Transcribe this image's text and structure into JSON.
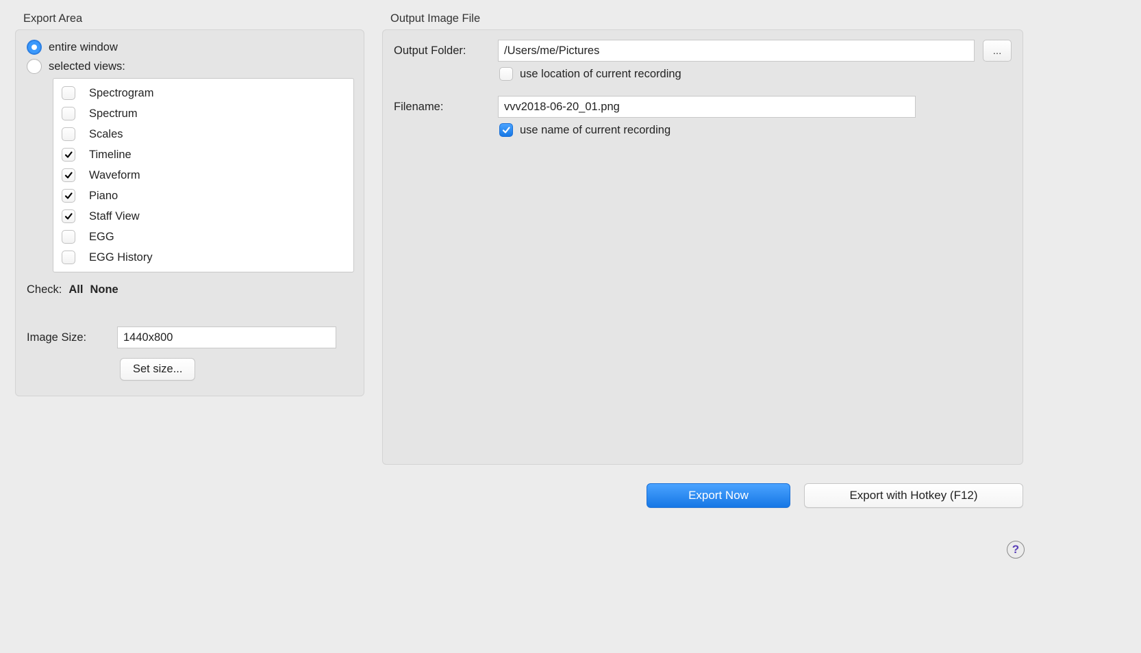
{
  "exportArea": {
    "groupLabel": "Export Area",
    "radio": {
      "entireWindow": {
        "label": "entire window",
        "checked": true
      },
      "selectedViews": {
        "label": "selected views:",
        "checked": false
      }
    },
    "views": [
      {
        "label": "Spectrogram",
        "checked": false
      },
      {
        "label": "Spectrum",
        "checked": false
      },
      {
        "label": "Scales",
        "checked": false
      },
      {
        "label": "Timeline",
        "checked": true
      },
      {
        "label": "Waveform",
        "checked": true
      },
      {
        "label": "Piano",
        "checked": true
      },
      {
        "label": "Staff View",
        "checked": true
      },
      {
        "label": "EGG",
        "checked": false
      },
      {
        "label": "EGG History",
        "checked": false
      }
    ],
    "checkLabel": "Check:",
    "checkAll": "All",
    "checkNone": "None",
    "imageSizeLabel": "Image Size:",
    "imageSizeValue": "1440x800",
    "setSizeButton": "Set size..."
  },
  "outputFile": {
    "groupLabel": "Output Image File",
    "outputFolderLabel": "Output Folder:",
    "outputFolderValue": "/Users/me/Pictures",
    "browseLabel": "...",
    "useLocation": {
      "label": "use location of current recording",
      "checked": false
    },
    "filenameLabel": "Filename:",
    "filenameValue": "vvv2018-06-20_01.png",
    "useName": {
      "label": "use name of current recording",
      "checked": true
    }
  },
  "footer": {
    "exportNow": "Export Now",
    "exportHotkey": "Export with Hotkey (F12)"
  },
  "help": "?"
}
